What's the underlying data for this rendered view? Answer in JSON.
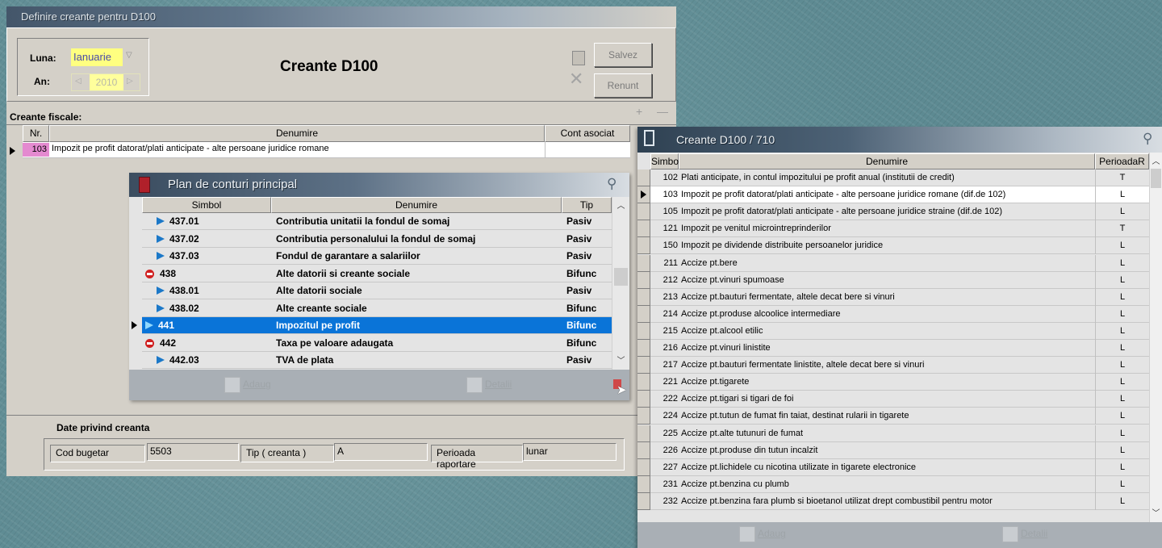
{
  "main_window": {
    "title": "Definire creante pentru D100",
    "heading": "Creante D100",
    "luna_label": "Luna:",
    "luna_value": "Ianuarie",
    "an_label": "An:",
    "an_value": "2010",
    "save_label": "Salvez",
    "cancel_label": "Renunt",
    "section_label": "Creante fiscale:",
    "columns": [
      "Nr.",
      "Denumire",
      "Cont asociat"
    ],
    "rows": [
      {
        "nr": "103",
        "denumire": "Impozit pe profit datorat/plati anticipate - alte persoane juridice romane",
        "cont": ""
      }
    ],
    "details_title": "Date privind creanta",
    "cod_bugetar_label": "Cod bugetar",
    "cod_bugetar_value": "5503",
    "tip_label": "Tip ( creanta )",
    "tip_value": "A",
    "perioada_label": "Perioada raportare",
    "perioada_value": "lunar"
  },
  "plan_window": {
    "title": "Plan de conturi principal",
    "columns": [
      "Simbol",
      "Denumire",
      "Tip"
    ],
    "rows": [
      {
        "kind": "child",
        "simbol": "437.01",
        "denumire": "Contributia unitatii la fondul de somaj",
        "tip": "Pasiv"
      },
      {
        "kind": "child",
        "simbol": "437.02",
        "denumire": "Contributia personalului la fondul de somaj",
        "tip": "Pasiv"
      },
      {
        "kind": "child",
        "simbol": "437.03",
        "denumire": "Fondul de garantare a salariilor",
        "tip": "Pasiv"
      },
      {
        "kind": "parent",
        "simbol": "438",
        "denumire": "Alte datorii si creante sociale",
        "tip": "Bifunc"
      },
      {
        "kind": "child",
        "simbol": "438.01",
        "denumire": "Alte datorii sociale",
        "tip": "Pasiv"
      },
      {
        "kind": "child",
        "simbol": "438.02",
        "denumire": "Alte creante sociale",
        "tip": "Bifunc"
      },
      {
        "kind": "selected",
        "simbol": "441",
        "denumire": "Impozitul pe profit",
        "tip": "Bifunc"
      },
      {
        "kind": "parent",
        "simbol": "442",
        "denumire": "Taxa pe valoare adaugata",
        "tip": "Bifunc"
      },
      {
        "kind": "child",
        "simbol": "442.03",
        "denumire": "TVA de plata",
        "tip": "Pasiv"
      }
    ],
    "add_label": "Adaug",
    "details_label": "Detalii"
  },
  "d100_window": {
    "title": "Creante D100 / 710",
    "columns": [
      "Simbol",
      "Denumire",
      "PerioadaR"
    ],
    "rows": [
      {
        "simbol": "102",
        "denumire": "Plati anticipate, in contul impozitului pe profit anual (institutii de credit)",
        "p": "T"
      },
      {
        "simbol": "103",
        "denumire": "Impozit pe profit datorat/plati anticipate - alte persoane juridice romane (dif.de 102)",
        "p": "L"
      },
      {
        "simbol": "105",
        "denumire": "Impozit pe profit datorat/plati anticipate - alte persoane juridice straine (dif.de 102)",
        "p": "L"
      },
      {
        "simbol": "121",
        "denumire": "Impozit pe venitul microintreprinderilor",
        "p": "T"
      },
      {
        "simbol": "150",
        "denumire": "Impozit pe dividende distribuite persoanelor juridice",
        "p": "L"
      },
      {
        "simbol": "211",
        "denumire": "Accize pt.bere",
        "p": "L"
      },
      {
        "simbol": "212",
        "denumire": "Accize pt.vinuri spumoase",
        "p": "L"
      },
      {
        "simbol": "213",
        "denumire": "Accize pt.bauturi fermentate, altele decat bere si vinuri",
        "p": "L"
      },
      {
        "simbol": "214",
        "denumire": "Accize pt.produse alcoolice intermediare",
        "p": "L"
      },
      {
        "simbol": "215",
        "denumire": "Accize pt.alcool etilic",
        "p": "L"
      },
      {
        "simbol": "216",
        "denumire": "Accize pt.vinuri linistite",
        "p": "L"
      },
      {
        "simbol": "217",
        "denumire": "Accize pt.bauturi fermentate linistite, altele decat bere si vinuri",
        "p": "L"
      },
      {
        "simbol": "221",
        "denumire": "Accize pt.tigarete",
        "p": "L"
      },
      {
        "simbol": "222",
        "denumire": "Accize pt.tigari si tigari de foi",
        "p": "L"
      },
      {
        "simbol": "224",
        "denumire": "Accize pt.tutun de fumat fin taiat, destinat rularii in tigarete",
        "p": "L"
      },
      {
        "simbol": "225",
        "denumire": "Accize pt.alte tutunuri de fumat",
        "p": "L"
      },
      {
        "simbol": "226",
        "denumire": "Accize pt.produse din tutun incalzit",
        "p": "L"
      },
      {
        "simbol": "227",
        "denumire": "Accize pt.lichidele cu nicotina utilizate in tigarete electronice",
        "p": "L"
      },
      {
        "simbol": "231",
        "denumire": "Accize pt.benzina cu plumb",
        "p": "L"
      },
      {
        "simbol": "232",
        "denumire": "Accize pt.benzina fara plumb si bioetanol utilizat drept combustibil pentru motor",
        "p": "L"
      }
    ],
    "selected_index": 1,
    "add_label": "Adaug",
    "details_label": "Detalii"
  }
}
